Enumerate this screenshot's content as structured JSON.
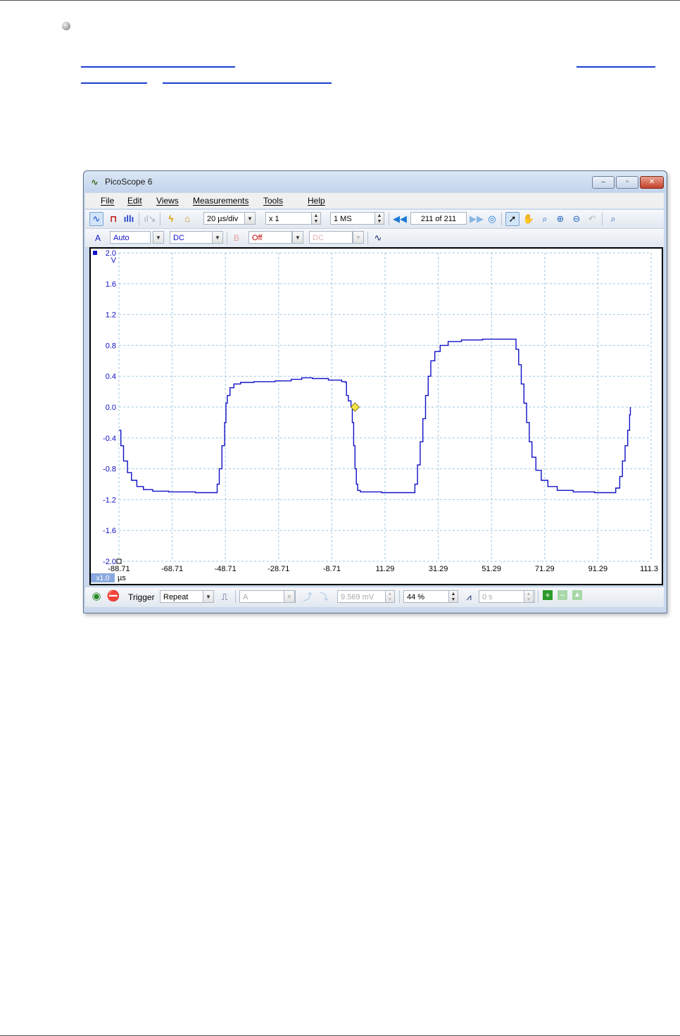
{
  "window": {
    "title": "PicoScope 6",
    "controls": {
      "minimize": "–",
      "maximize": "▫",
      "close": "✕"
    }
  },
  "menu": [
    "File",
    "Edit",
    "Views",
    "Measurements",
    "Tools",
    "Help"
  ],
  "toolbar": {
    "timebase": "20 µs/div",
    "zoom": "x 1",
    "samples": "1 MS",
    "buffer_position": "211 of 211"
  },
  "channels": {
    "a": {
      "label": "A",
      "range": "Auto",
      "coupling": "DC"
    },
    "b": {
      "label": "B",
      "range": "Off",
      "coupling": "DC"
    }
  },
  "chart_data": {
    "type": "line",
    "x_unit": "µs",
    "y_unit": "V",
    "zoom_badge": "x1.0",
    "xlim": [
      -88.71,
      111.3
    ],
    "ylim": [
      -2.0,
      2.0
    ],
    "x_ticks": [
      "-88.71",
      "-68.71",
      "-48.71",
      "-28.71",
      "-8.71",
      "11.29",
      "31.29",
      "51.29",
      "71.29",
      "91.29",
      "111.3"
    ],
    "y_ticks": [
      "2.0",
      "1.6",
      "1.2",
      "0.8",
      "0.4",
      "0.0",
      "-0.4",
      "-0.8",
      "-1.2",
      "-1.6",
      "-2.0"
    ],
    "grid": true,
    "series": [
      {
        "color": "#1010c8",
        "points": [
          [
            -88.71,
            -0.3
          ],
          [
            -88.0,
            -0.5
          ],
          [
            -87.0,
            -0.7
          ],
          [
            -85.5,
            -0.85
          ],
          [
            -84.0,
            -0.95
          ],
          [
            -82.0,
            -1.03
          ],
          [
            -79.5,
            -1.07
          ],
          [
            -76.0,
            -1.09
          ],
          [
            -70.0,
            -1.1
          ],
          [
            -60.0,
            -1.11
          ],
          [
            -54.0,
            -1.11
          ],
          [
            -52.0,
            -1.11
          ],
          [
            -51.8,
            -1.0
          ],
          [
            -51.0,
            -0.8
          ],
          [
            -50.0,
            -0.5
          ],
          [
            -49.0,
            -0.2
          ],
          [
            -48.5,
            0.05
          ],
          [
            -48.0,
            0.15
          ],
          [
            -47.0,
            0.25
          ],
          [
            -45.5,
            0.3
          ],
          [
            -43.0,
            0.32
          ],
          [
            -38.0,
            0.33
          ],
          [
            -30.0,
            0.34
          ],
          [
            -24.0,
            0.36
          ],
          [
            -20.0,
            0.38
          ],
          [
            -16.0,
            0.37
          ],
          [
            -10.0,
            0.35
          ],
          [
            -5.0,
            0.33
          ],
          [
            -3.5,
            0.32
          ],
          [
            -3.2,
            0.15
          ],
          [
            -2.5,
            0.08
          ],
          [
            -1.5,
            0.0
          ],
          [
            -1.0,
            -0.2
          ],
          [
            -0.5,
            -0.5
          ],
          [
            0.0,
            -0.8
          ],
          [
            0.5,
            -1.0
          ],
          [
            1.0,
            -1.08
          ],
          [
            2.0,
            -1.1
          ],
          [
            10.0,
            -1.11
          ],
          [
            20.0,
            -1.11
          ],
          [
            22.0,
            -1.11
          ],
          [
            22.5,
            -1.0
          ],
          [
            23.5,
            -0.75
          ],
          [
            24.5,
            -0.45
          ],
          [
            25.5,
            -0.15
          ],
          [
            26.5,
            0.15
          ],
          [
            27.5,
            0.4
          ],
          [
            28.5,
            0.6
          ],
          [
            30.0,
            0.72
          ],
          [
            32.0,
            0.8
          ],
          [
            35.0,
            0.85
          ],
          [
            40.0,
            0.87
          ],
          [
            48.0,
            0.88
          ],
          [
            57.0,
            0.88
          ],
          [
            60.0,
            0.88
          ],
          [
            60.5,
            0.75
          ],
          [
            61.5,
            0.55
          ],
          [
            62.5,
            0.3
          ],
          [
            63.5,
            0.05
          ],
          [
            64.5,
            -0.2
          ],
          [
            65.5,
            -0.45
          ],
          [
            66.5,
            -0.65
          ],
          [
            68.0,
            -0.82
          ],
          [
            70.0,
            -0.95
          ],
          [
            72.5,
            -1.03
          ],
          [
            76.0,
            -1.08
          ],
          [
            82.0,
            -1.1
          ],
          [
            90.0,
            -1.11
          ],
          [
            97.0,
            -1.11
          ],
          [
            98.0,
            -1.05
          ],
          [
            99.5,
            -0.9
          ],
          [
            100.5,
            -0.7
          ],
          [
            101.5,
            -0.5
          ],
          [
            102.5,
            -0.3
          ],
          [
            103.2,
            -0.1
          ],
          [
            103.5,
            0.0
          ]
        ]
      }
    ]
  },
  "status": {
    "trigger_label": "Trigger",
    "trigger_mode": "Repeat",
    "trigger_source": "A",
    "threshold": "9.569 mV",
    "pre_trigger": "44 %",
    "delay": "0 s"
  }
}
